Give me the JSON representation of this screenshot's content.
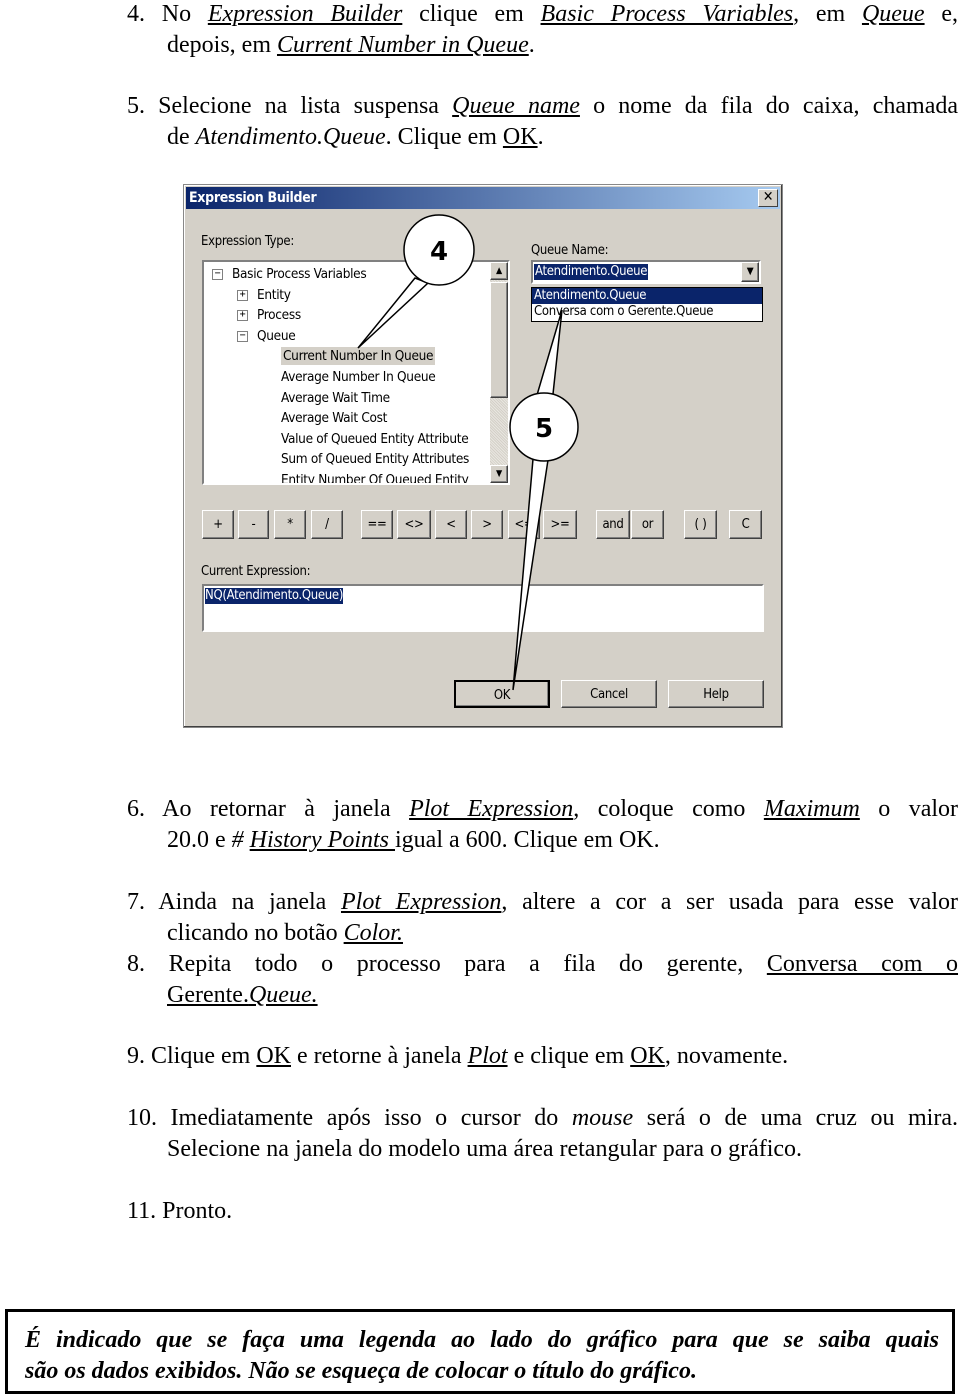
{
  "steps": [
    {
      "lines": [
        [
          {
            "t": "4. No ",
            "s": ""
          },
          {
            "t": "Expression Builder",
            "s": "ui"
          },
          {
            "t": " clique em ",
            "s": ""
          },
          {
            "t": "Basic Process Variables",
            "s": "ui"
          },
          {
            "t": ", em ",
            "s": ""
          },
          {
            "t": "Queue",
            "s": "ui"
          },
          {
            "t": " e,",
            "s": ""
          }
        ],
        [
          {
            "t": "depois, em ",
            "s": ""
          },
          {
            "t": "Current Number in Queue",
            "s": "ui"
          },
          {
            "t": ".",
            "s": ""
          }
        ]
      ]
    },
    {
      "lines": [
        [
          {
            "t": "5. Selecione na lista suspensa ",
            "s": ""
          },
          {
            "t": "Queue name",
            "s": "ui"
          },
          {
            "t": " o nome da fila do caixa, chamada",
            "s": ""
          }
        ],
        [
          {
            "t": "de ",
            "s": ""
          },
          {
            "t": "Atendimento.Queue",
            "s": "it"
          },
          {
            "t": ". Clique em ",
            "s": ""
          },
          {
            "t": "OK",
            "s": "un"
          },
          {
            "t": ".",
            "s": ""
          }
        ]
      ]
    },
    {
      "lines": [
        [
          {
            "t": "6. Ao retornar à janela ",
            "s": ""
          },
          {
            "t": "Plot Expression",
            "s": "ui"
          },
          {
            "t": ", coloque como ",
            "s": ""
          },
          {
            "t": "Maximum",
            "s": "ui"
          },
          {
            "t": " o valor",
            "s": ""
          }
        ],
        [
          {
            "t": "20.0 e ",
            "s": ""
          },
          {
            "t": "# ",
            "s": "it"
          },
          {
            "t": "History Points ",
            "s": "ui"
          },
          {
            "t": "igual a 600. Clique em OK.",
            "s": ""
          }
        ]
      ]
    },
    {
      "lines": [
        [
          {
            "t": "7. Ainda na janela ",
            "s": ""
          },
          {
            "t": "Plot Expression",
            "s": "ui"
          },
          {
            "t": ", altere a cor a ser usada para esse valor",
            "s": ""
          }
        ],
        [
          {
            "t": "clicando no botão ",
            "s": ""
          },
          {
            "t": "Color.",
            "s": "ui"
          }
        ]
      ]
    },
    {
      "lines": [
        [
          {
            "t": "8. Repita todo o processo para a fila do gerente, ",
            "s": ""
          },
          {
            "t": "Conversa com o",
            "s": "un"
          }
        ],
        [
          {
            "t": "Gerente.",
            "s": "un"
          },
          {
            "t": "Queue.",
            "s": "ui"
          }
        ]
      ]
    },
    {
      "lines": [
        [
          {
            "t": "9. Clique em ",
            "s": ""
          },
          {
            "t": "OK",
            "s": "un"
          },
          {
            "t": " e retorne à janela ",
            "s": ""
          },
          {
            "t": "Plot",
            "s": "ui"
          },
          {
            "t": " e clique em ",
            "s": ""
          },
          {
            "t": "OK",
            "s": "un"
          },
          {
            "t": ", novamente.",
            "s": ""
          }
        ]
      ]
    },
    {
      "lines": [
        [
          {
            "t": "10. Imediatamente após isso o cursor do ",
            "s": ""
          },
          {
            "t": "mouse",
            "s": "it"
          },
          {
            "t": " será o de uma cruz ou mira.",
            "s": ""
          }
        ],
        [
          {
            "t": "Selecione na janela do modelo uma área retangular para o gráfico.",
            "s": ""
          }
        ]
      ]
    },
    {
      "lines": [
        [
          {
            "t": "11. Pronto.",
            "s": ""
          }
        ]
      ]
    }
  ],
  "dialog": {
    "title": "Expression Builder",
    "close": "✕",
    "expression_type_label": "Expression Type:",
    "tree": [
      {
        "label": "Basic Process Variables",
        "level": 0,
        "toggle": "−"
      },
      {
        "label": "Entity",
        "level": 1,
        "toggle": "+"
      },
      {
        "label": "Process",
        "level": 1,
        "toggle": "+"
      },
      {
        "label": "Queue",
        "level": 1,
        "toggle": "−"
      },
      {
        "label": "Current Number In Queue",
        "level": 2,
        "selected": true
      },
      {
        "label": "Average Number In Queue",
        "level": 2
      },
      {
        "label": "Average Wait Time",
        "level": 2
      },
      {
        "label": "Average Wait Cost",
        "level": 2
      },
      {
        "label": "Value of Queued Entity Attribute",
        "level": 2
      },
      {
        "label": "Sum of Queued Entity Attributes",
        "level": 2
      },
      {
        "label": "Entity Number Of Queued Entity",
        "level": 2
      }
    ],
    "queue_name_label": "Queue Name:",
    "queue_name_value": "Atendimento.Queue",
    "queue_options": [
      "Atendimento.Queue",
      "Conversa com o Gerente.Queue"
    ],
    "operators": [
      "+",
      "-",
      "*",
      "/",
      "==",
      "<>",
      "<",
      ">",
      "<=",
      ">=",
      "and",
      "or",
      "( )",
      "C"
    ],
    "current_expression_label": "Current Expression:",
    "current_expression_value": "NQ(Atendimento.Queue)",
    "ok": "OK",
    "cancel": "Cancel",
    "help": "Help",
    "callouts": [
      "4",
      "5"
    ]
  },
  "note": {
    "lines": [
      "É indicado que se faça uma legenda ao lado do gráfico para que se saiba quais",
      "são os dados exibidos. Não se esqueça de colocar o título do gráfico."
    ]
  }
}
